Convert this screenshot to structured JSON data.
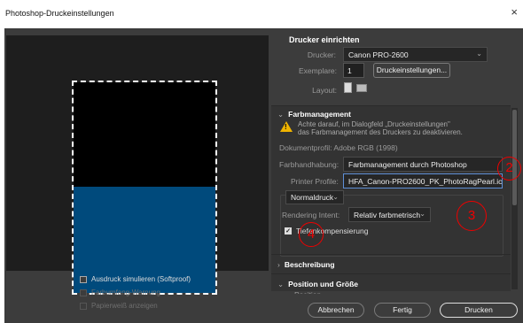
{
  "window": {
    "title": "Photoshop-Druckeinstellungen",
    "close_glyph": "×"
  },
  "preview_options": [
    {
      "label": "Ausdruck simulieren (Softproof)",
      "enabled": true,
      "checked": false
    },
    {
      "label": "Farbumfang-Warnung",
      "enabled": false,
      "checked": false
    },
    {
      "label": "Papierweiß anzeigen",
      "enabled": false,
      "checked": false
    }
  ],
  "printer_setup": {
    "heading": "Drucker einrichten",
    "printer_label": "Drucker:",
    "printer_value": "Canon PRO-2600",
    "copies_label": "Exemplare:",
    "copies_value": "1",
    "print_settings_button": "Druckeinstellungen...",
    "layout_label": "Layout:"
  },
  "color_management": {
    "heading": "Farbmanagement",
    "warning_line1": "Achte darauf, im Dialogfeld „Druckeinstellungen\"",
    "warning_line2": "das Farbmanagement des Druckers zu deaktivieren.",
    "document_profile": "Dokumentprofil: Adobe RGB (1998)",
    "color_handling_label": "Farbhandhabung:",
    "color_handling_value": "Farbmanagement durch Photoshop",
    "printer_profile_label": "Printer Profile:",
    "printer_profile_value": "HFA_Canon-PRO2600_PK_PhotoRagPearl.icc",
    "normal_print": "Normaldruck",
    "rendering_intent_label": "Rendering Intent:",
    "rendering_intent_value": "Relativ farbmetrisch",
    "bpc_label": "Tiefenkompensierung",
    "bpc_checked": true
  },
  "sections": {
    "description": "Beschreibung",
    "position_size": "Position und Größe",
    "position": "Position"
  },
  "annotations": [
    "2",
    "3",
    "4"
  ],
  "buttons": {
    "cancel": "Abbrechen",
    "done": "Fertig",
    "print": "Drucken"
  },
  "colors": {
    "annotation_red": "#e00000",
    "print_blue": "#004a7c",
    "warning_yellow": "#f0b400"
  }
}
